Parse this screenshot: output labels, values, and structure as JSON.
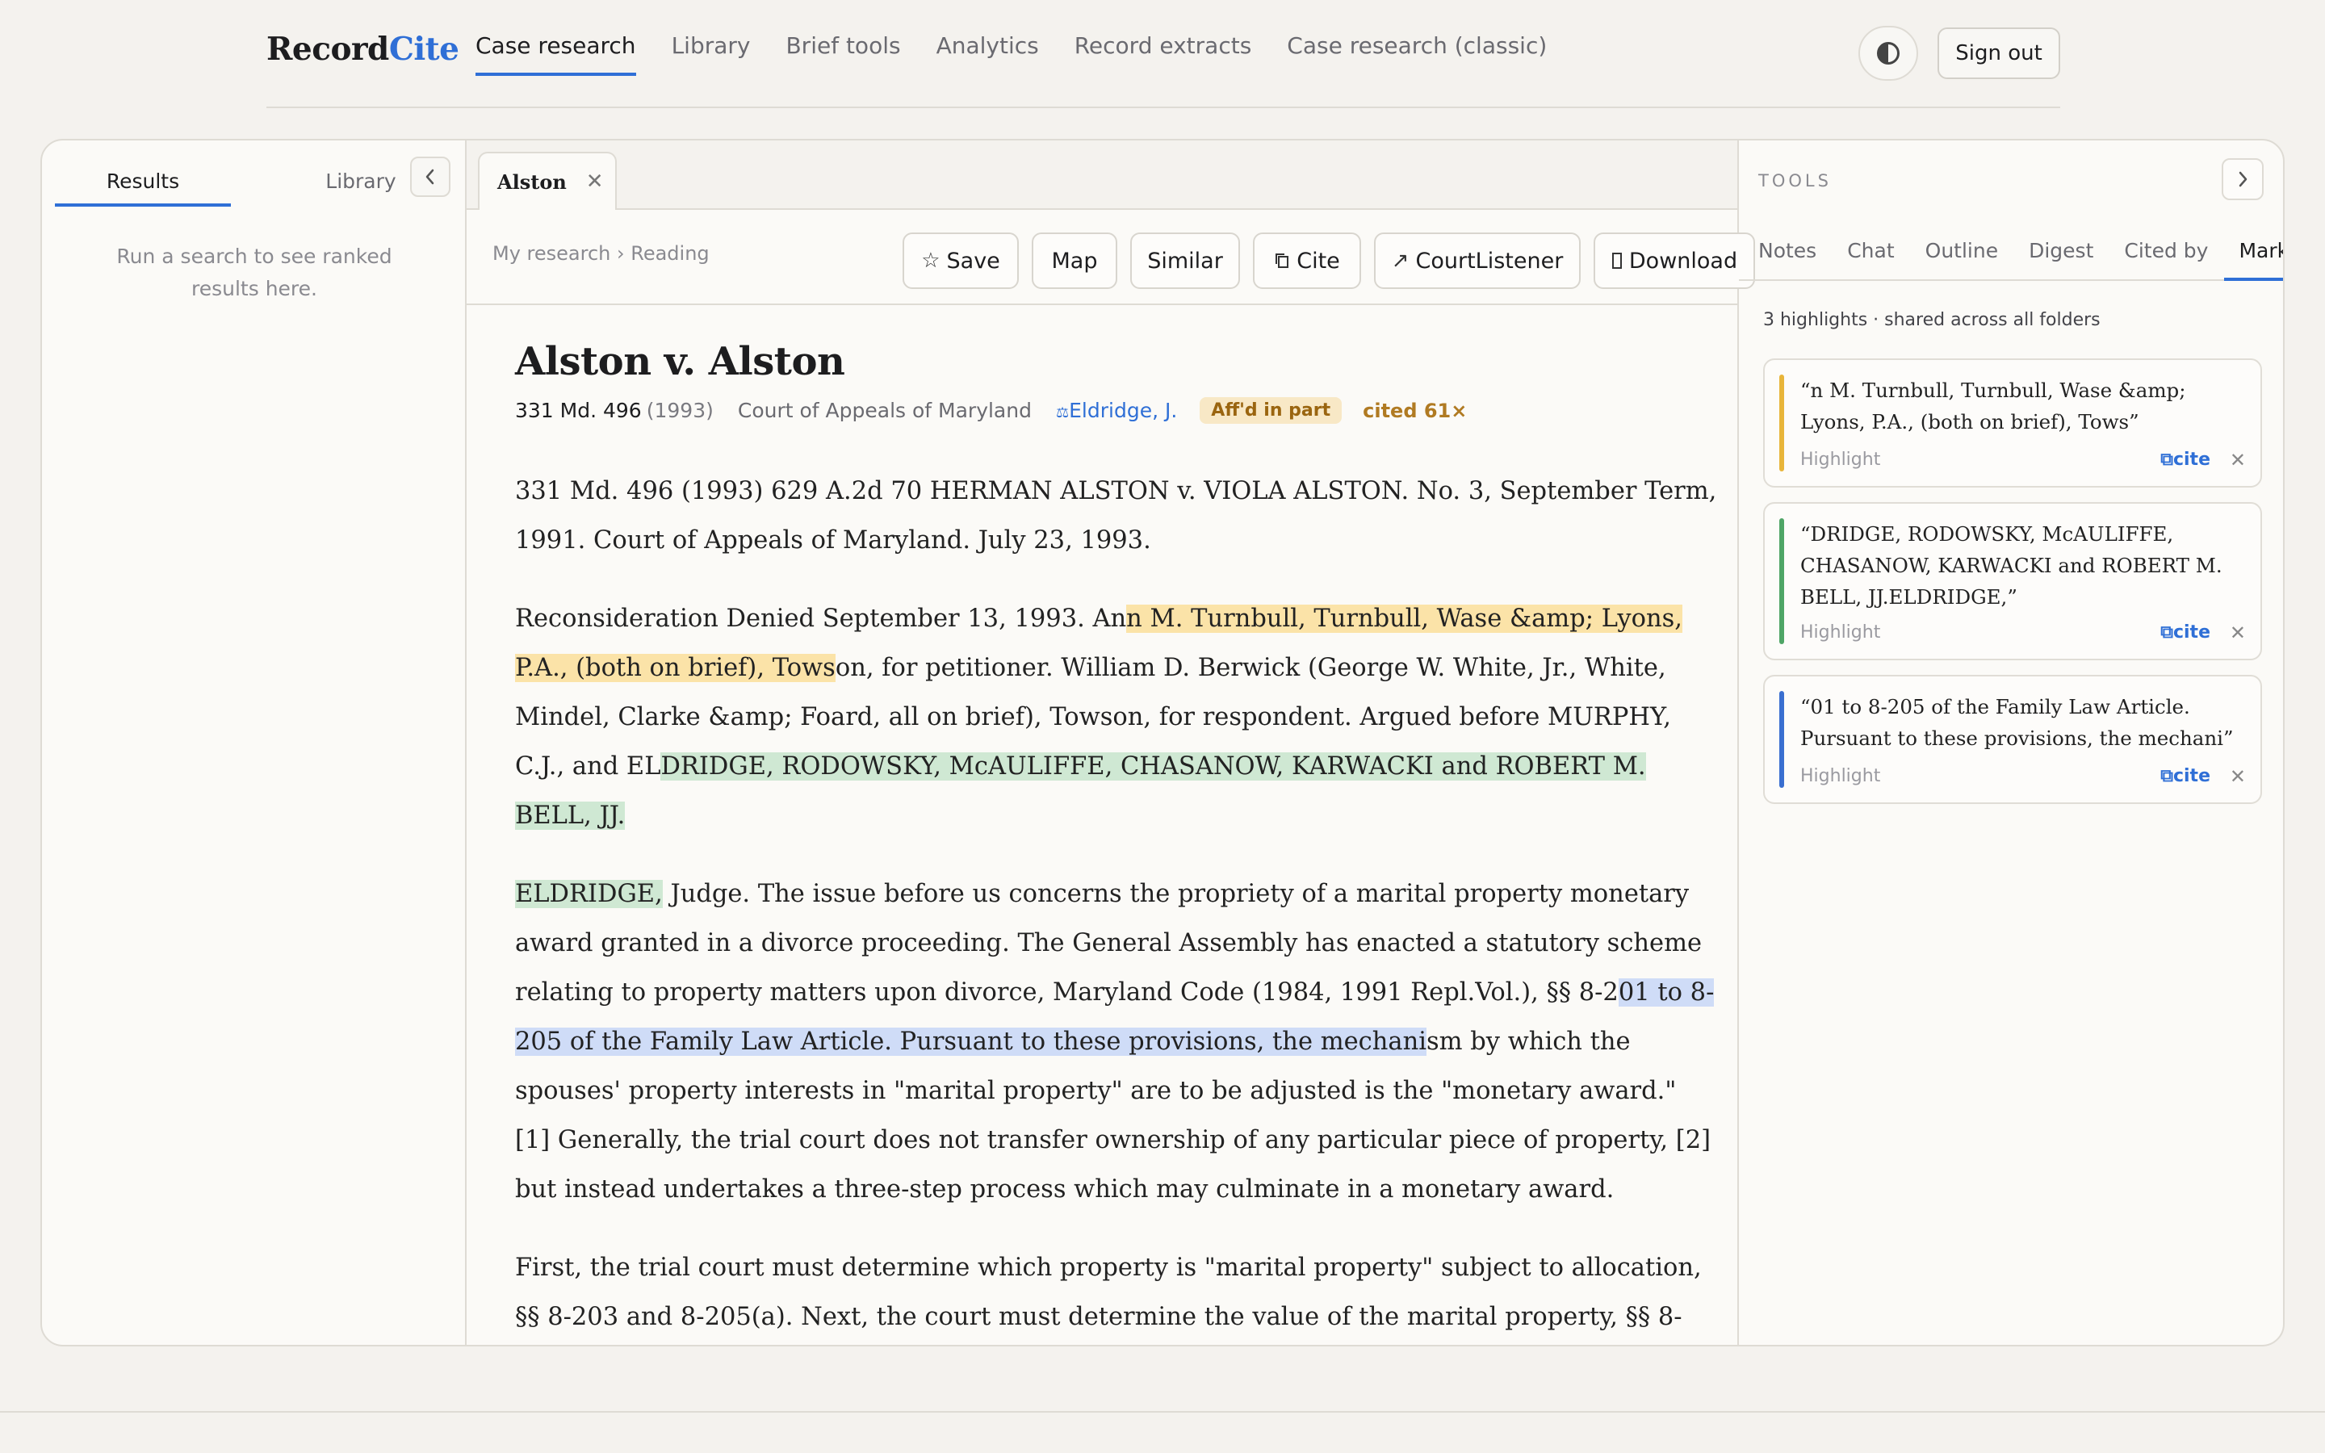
{
  "brand": {
    "part1": "Record",
    "part2": "Cite"
  },
  "nav": {
    "items": [
      {
        "label": "Case research"
      },
      {
        "label": "Library"
      },
      {
        "label": "Brief tools"
      },
      {
        "label": "Analytics"
      },
      {
        "label": "Record extracts"
      },
      {
        "label": "Case research (classic)"
      }
    ],
    "active": "Case research"
  },
  "header": {
    "signout_label": "Sign out",
    "theme_icon": "contrast-icon"
  },
  "left_panel": {
    "tabs": [
      "Results",
      "Library"
    ],
    "active_tab": "Results",
    "collapse_icon": "chevron-left-icon",
    "empty_message": "Run a search to see ranked results here."
  },
  "doc_tab": {
    "label": "Alston",
    "close_icon": "close-icon"
  },
  "toolbar": {
    "breadcrumb": "My research › Reading",
    "buttons": {
      "save": "Save",
      "map": "Map",
      "similar": "Similar",
      "cite": "Cite",
      "courtlistener": "CourtListener",
      "download": "Download"
    }
  },
  "case": {
    "title": "Alston v. Alston",
    "citation": "331 Md. 496",
    "year": "(1993)",
    "court": "Court of Appeals of Maryland",
    "judge": "Eldridge, J.",
    "status_badge": "Aff'd in part",
    "cited_count": "cited 61×",
    "p1": "331 Md. 496 (1993) 629 A.2d 70 HERMAN ALSTON v. VIOLA ALSTON. No. 3, September Term, 1991. Court of Appeals of Maryland. July 23, 1993.",
    "p2_a": "Reconsideration Denied September 13, 1993. An",
    "p2_hl1": "n M. Turnbull, Turnbull, Wase &amp; Lyons, P.A., (both on brief), Tows",
    "p2_b": "on, for petitioner. William D. Berwick (George W. White, Jr., White, Mindel, Clarke &amp; Foard, all on brief), Towson, for respondent. Argued before MURPHY, C.J., and EL",
    "p2_hl2": "DRIDGE, RODOWSKY, McAULIFFE, CHASANOW, KARWACKI and ROBERT M. BELL, JJ.",
    "p3_hl2": "ELDRIDGE,",
    "p3_a": " Judge. The issue before us concerns the propriety of a marital property monetary award granted in a divorce proceeding. The General Assembly has enacted a statutory scheme relating to property matters upon divorce, Maryland Code (1984, 1991 Repl.Vol.), §§ 8-2",
    "p3_hl3": "01 to 8-205 of the Family Law Article. Pursuant to these provisions, the mechani",
    "p3_b": "sm by which the spouses' property interests in \"marital property\" are to be adjusted is the \"monetary award.\" [1] Generally, the trial court does not transfer ownership of any particular piece of property, [2] but instead undertakes a three-step process which may culminate in a monetary award.",
    "p4": "First, the trial court must determine which property is \"marital property\" subject to allocation, §§ 8-203 and 8-205(a). Next, the court must determine the value of the marital property, §§ 8-"
  },
  "tools": {
    "label": "TOOLS",
    "expand_icon": "chevron-right-icon",
    "tabs": [
      "Notes",
      "Chat",
      "Outline",
      "Digest",
      "Cited by",
      "Marks"
    ],
    "active_tab": "Marks",
    "summary": "3 highlights · shared across all folders",
    "marks": [
      {
        "quote": "“n M. Turnbull, Turnbull, Wase &amp; Lyons, P.A., (both on brief), Tows”",
        "type": "Highlight",
        "cite_label": "cite",
        "color": "#e8b53a"
      },
      {
        "quote": "“DRIDGE, RODOWSKY, McAULIFFE, CHASANOW, KARWACKI and ROBERT M. BELL, JJ.ELDRIDGE,”",
        "type": "Highlight",
        "cite_label": "cite",
        "color": "#4fa566"
      },
      {
        "quote": "“01 to 8-205 of the Family Law Article. Pursuant to these provisions, the mechani”",
        "type": "Highlight",
        "cite_label": "cite",
        "color": "#3a6fd0"
      }
    ]
  },
  "colors": {
    "accent": "#2f6fd6",
    "highlight_yellow": "#fbe3a8",
    "highlight_green": "#cfe8d3",
    "highlight_blue": "#cfdcf7"
  }
}
